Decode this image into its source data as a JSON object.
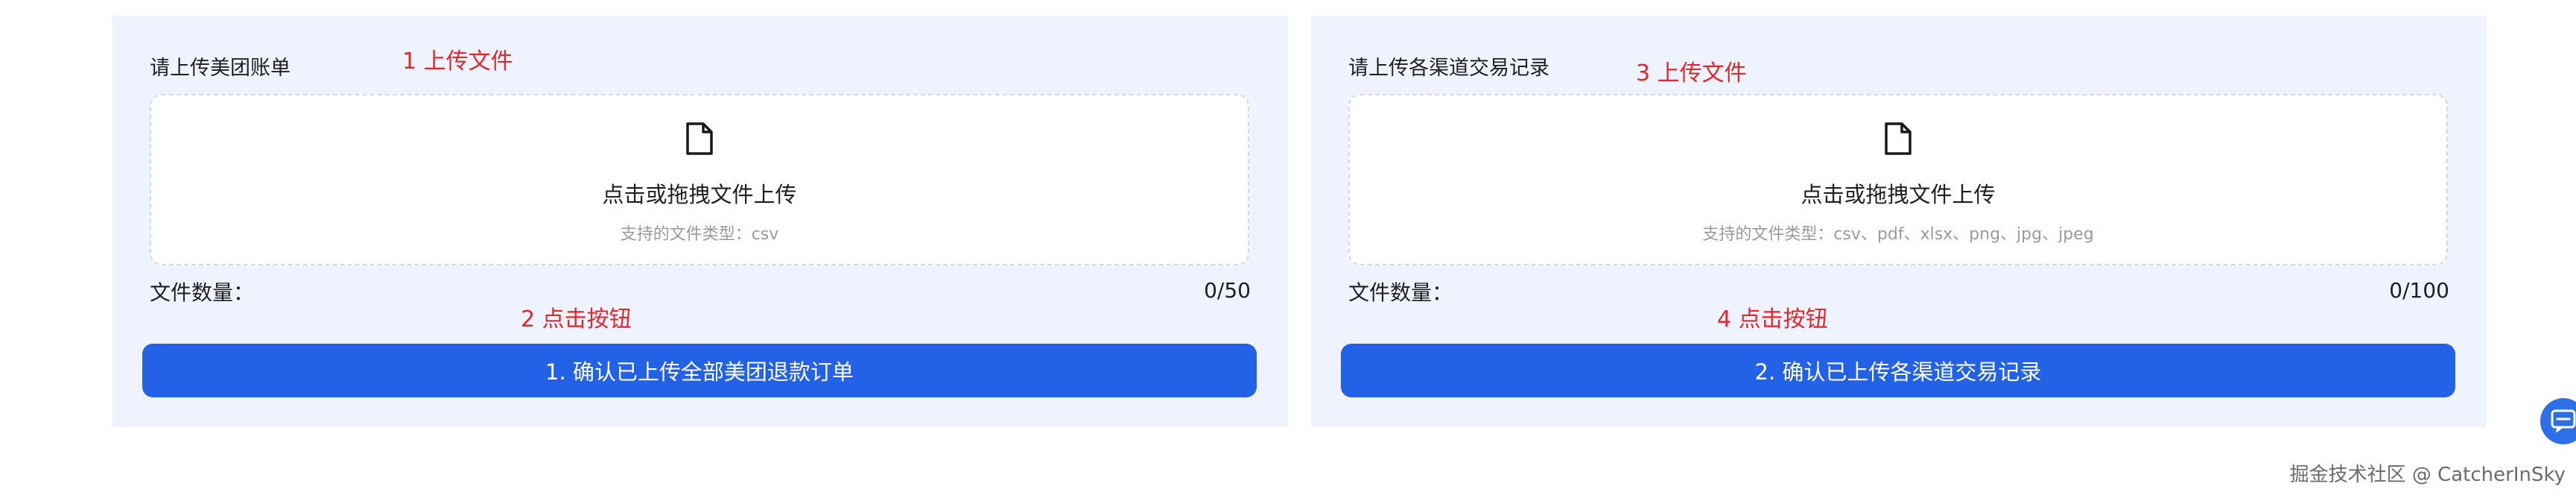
{
  "panels": [
    {
      "label": "请上传美团账单",
      "upload_annotation": "1 上传文件",
      "dropzone_text": "点击或拖拽文件上传",
      "dropzone_hint": "支持的文件类型：csv",
      "count_label": "文件数量：",
      "count_value": "0/50",
      "button_annotation": "2 点击按钮",
      "button_label": "1. 确认已上传全部美团退款订单"
    },
    {
      "label": "请上传各渠道交易记录",
      "upload_annotation": "3 上传文件",
      "dropzone_text": "点击或拖拽文件上传",
      "dropzone_hint": "支持的文件类型：csv、pdf、xlsx、png、jpg、jpeg",
      "count_label": "文件数量：",
      "count_value": "0/100",
      "button_annotation": "4 点击按钮",
      "button_label": "2. 确认已上传各渠道交易记录"
    }
  ],
  "watermark": "掘金技术社区 @ CatcherInSky",
  "icons": {
    "dropzone": "file-icon",
    "floating": "chat-icon"
  },
  "colors": {
    "panel_bg": "#eef3ff",
    "primary": "#2361e6",
    "annotation": "#e2272b"
  }
}
